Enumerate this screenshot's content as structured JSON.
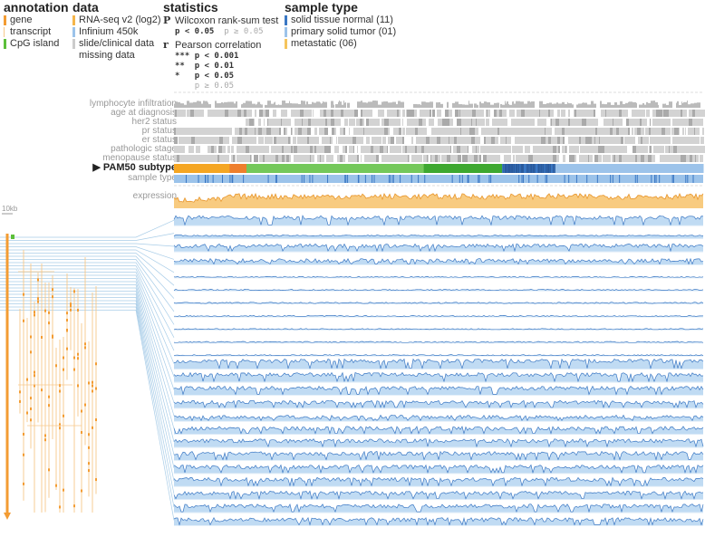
{
  "legend": {
    "annotation": {
      "title": "annotation",
      "items": [
        {
          "label": "gene",
          "color": "#f39c33"
        },
        {
          "label": "transcript",
          "color": "#f7c98a"
        },
        {
          "label": "CpG island",
          "color": "#5cbf3a"
        }
      ]
    },
    "data": {
      "title": "data",
      "items": [
        {
          "label": "RNA-seq v2 (log2)",
          "color": "#f5b54a"
        },
        {
          "label": "Infinium 450k",
          "color": "#9cc3ea"
        },
        {
          "label": "slide/clinical data",
          "color": "#cccccc"
        },
        {
          "label": "missing data",
          "color": "#ffffff"
        }
      ]
    },
    "statistics": {
      "title": "statistics",
      "wilcoxon": {
        "symbol": "P",
        "label": "Wilcoxon rank-sum test",
        "sig": "p < 0.05",
        "nonsig": "p ≥ 0.05"
      },
      "pearson": {
        "symbol": "r",
        "label": "Pearson correlation",
        "levels": [
          {
            "stars": "***",
            "text": "p < 0.001"
          },
          {
            "stars": "**",
            "text": "p < 0.01"
          },
          {
            "stars": "*",
            "text": "p < 0.05"
          },
          {
            "stars": "",
            "text": "p ≥ 0.05"
          }
        ]
      }
    },
    "sample_type": {
      "title": "sample type",
      "items": [
        {
          "label": "solid tissue normal (11)",
          "color": "#3b78c4"
        },
        {
          "label": "primary solid tumor (01)",
          "color": "#9cc3ea"
        },
        {
          "label": "metastatic (06)",
          "color": "#f5c45c"
        }
      ]
    }
  },
  "tracks": {
    "clinical": [
      "lymphocyte infiltration",
      "age at diagnosis",
      "her2 status",
      "pr status",
      "er status",
      "pathologic stage",
      "menopause status"
    ],
    "pam50_marker": "▶",
    "pam50": "PAM50 subtype",
    "sample_type": "sample type",
    "expression": "expression"
  },
  "scale_label": "10kb",
  "chart_data": {
    "type": "heatmap",
    "title": "",
    "pam50_segments": [
      {
        "start": 0.0,
        "end": 0.105,
        "color": "#f5a623"
      },
      {
        "start": 0.105,
        "end": 0.137,
        "color": "#ee7f2d"
      },
      {
        "start": 0.137,
        "end": 0.472,
        "color": "#74c85a"
      },
      {
        "start": 0.472,
        "end": 0.62,
        "color": "#3ea830"
      },
      {
        "start": 0.62,
        "end": 0.72,
        "color": "#3b78c4"
      },
      {
        "start": 0.72,
        "end": 1.0,
        "color": "#9cc3ea"
      }
    ],
    "methylation_probe_rows": 24,
    "methylation_row_levels": [
      0.7,
      0.25,
      0.5,
      0.35,
      0.05,
      0.06,
      0.07,
      0.05,
      0.05,
      0.06,
      0.05,
      0.7,
      0.65,
      0.6,
      0.5,
      0.35,
      0.5,
      0.55,
      0.6,
      0.55,
      0.6,
      0.55,
      0.55,
      0.5
    ],
    "sample_type_counts": {
      "solid tissue normal (11)": 0,
      "primary solid tumor (01)": 0,
      "metastatic (06)": 0
    },
    "colors": {
      "expression": "#f5b54a",
      "expression_line": "#e8952a",
      "methylation_fill": "#b9d7f2",
      "methylation_line": "#3b78c4",
      "clinical": "#cccccc",
      "gene": "#f39c33",
      "transcript": "#f7c98a",
      "cpg": "#5cbf3a",
      "connector": "#a9cde8"
    }
  }
}
